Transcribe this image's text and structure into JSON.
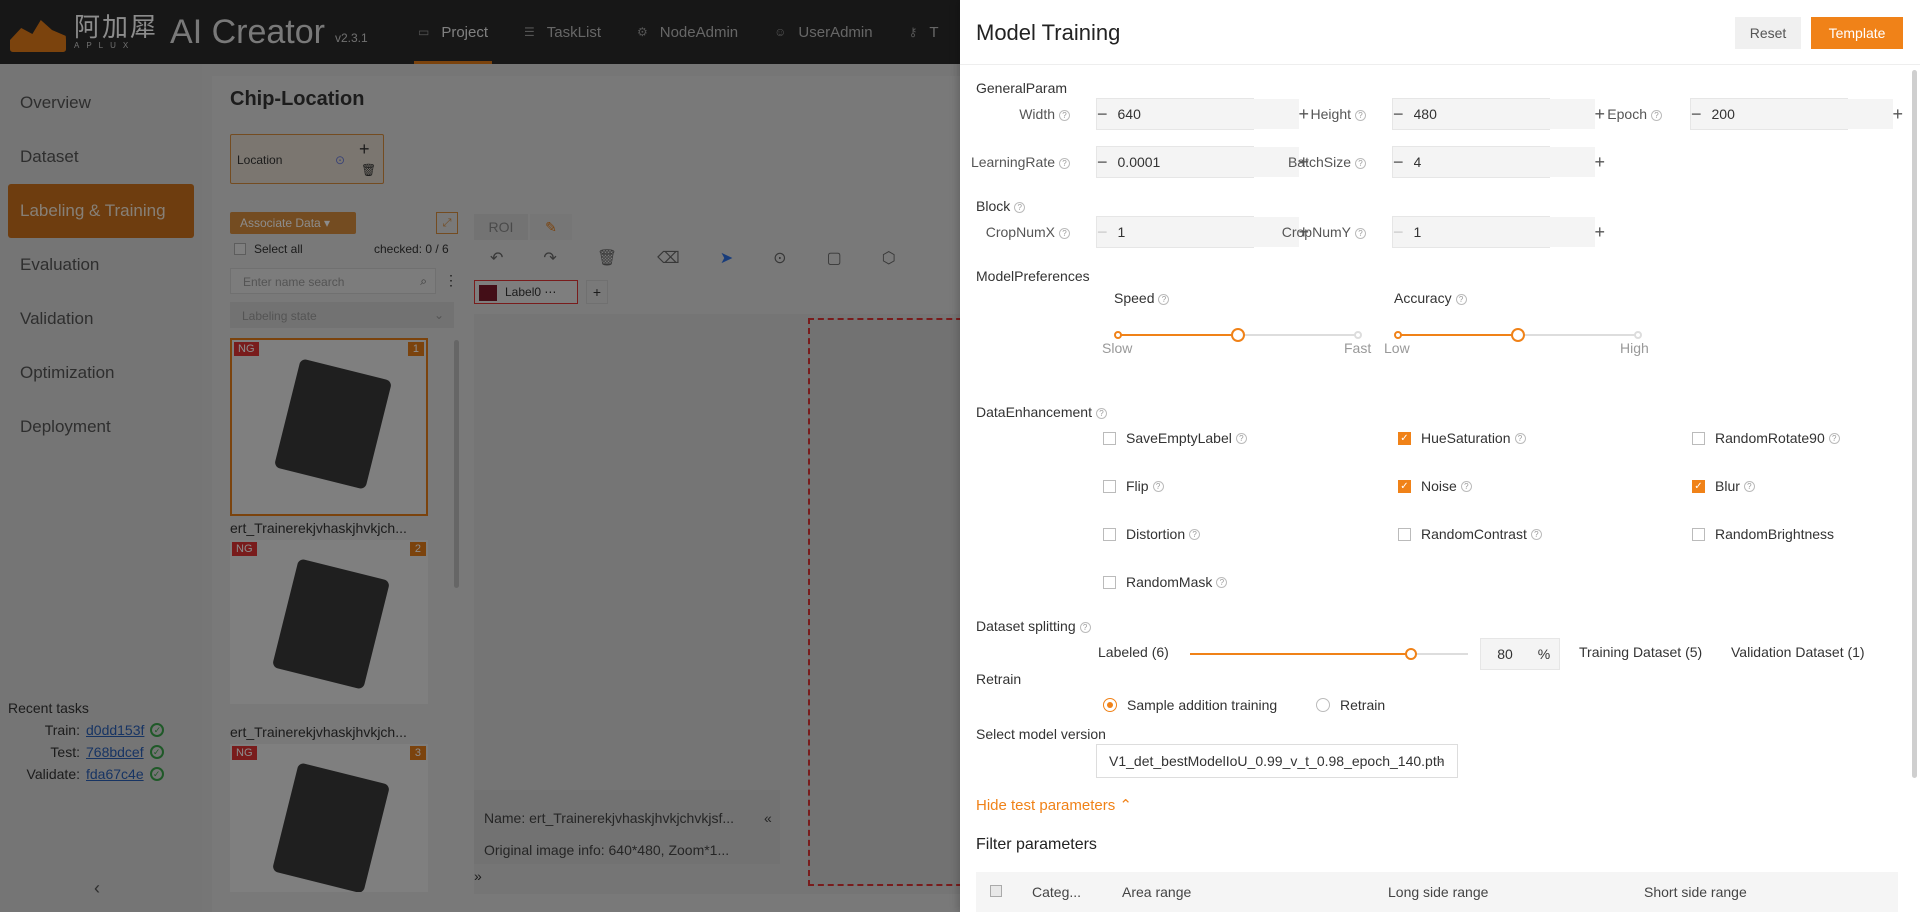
{
  "app": {
    "logo_cn": "阿加犀",
    "logo_sub": "APLUX",
    "name": "AI Creator",
    "version": "v2.3.1"
  },
  "nav": [
    {
      "label": "Project",
      "icon": "folder-icon"
    },
    {
      "label": "TaskList",
      "icon": "list-icon"
    },
    {
      "label": "NodeAdmin",
      "icon": "node-icon"
    },
    {
      "label": "UserAdmin",
      "icon": "user-icon"
    },
    {
      "label": "T",
      "icon": "key-icon"
    }
  ],
  "sidebar": {
    "items": [
      {
        "label": "Overview"
      },
      {
        "label": "Dataset"
      },
      {
        "label": "Labeling & Training"
      },
      {
        "label": "Evaluation"
      },
      {
        "label": "Validation"
      },
      {
        "label": "Optimization"
      },
      {
        "label": "Deployment"
      }
    ],
    "active_index": 2,
    "recent_title": "Recent tasks",
    "recent": [
      {
        "label": "Train:",
        "id": "d0dd153f"
      },
      {
        "label": "Test:",
        "id": "768bdcef"
      },
      {
        "label": "Validate:",
        "id": "fda67c4e"
      }
    ],
    "collapse": "‹"
  },
  "project": {
    "title": "Chip-Location",
    "location_card": "Location",
    "associate_label": "Associate Data",
    "select_all": "Select all",
    "checked": "checked:  0 / 6",
    "search_placeholder": "Enter name search",
    "labeling_state": "Labeling state",
    "images": [
      {
        "tag": "NG",
        "num": "1",
        "caption": "ert_Trainerekjvhaskjhvkjch..."
      },
      {
        "tag": "NG",
        "num": "2",
        "caption": "ert_Trainerekjvhaskjhvkjch..."
      },
      {
        "tag": "NG",
        "num": "3",
        "caption": ""
      }
    ],
    "roi_tab": "ROI",
    "label_name": "Label0",
    "info_name": "Name:  ert_Trainerekjvhaskjhvkjchvkjsf...",
    "info_image": "Original image info:  640*480,  Zoom*1...",
    "info_collapse": "«",
    "info_expand": "»"
  },
  "panel": {
    "title": "Model Training",
    "reset": "Reset",
    "template": "Template",
    "general_param": "GeneralParam",
    "width_label": "Width",
    "width_value": "640",
    "height_label": "Height",
    "height_value": "480",
    "epoch_label": "Epoch",
    "epoch_value": "200",
    "lr_label": "LearningRate",
    "lr_value": "0.0001",
    "batch_label": "BatchSize",
    "batch_value": "4",
    "block": "Block",
    "cropx_label": "CropNumX",
    "cropx_value": "1",
    "cropy_label": "CropNumY",
    "cropy_value": "1",
    "model_pref": "ModelPreferences",
    "speed_label": "Speed",
    "speed_min": "Slow",
    "speed_max": "Fast",
    "speed_level": 0.5,
    "accuracy_label": "Accuracy",
    "accuracy_min": "Low",
    "accuracy_max": "High",
    "accuracy_level": 0.5,
    "data_enh": "DataEnhancement",
    "enh": [
      {
        "label": "SaveEmptyLabel",
        "checked": false
      },
      {
        "label": "HueSaturation",
        "checked": true
      },
      {
        "label": "RandomRotate90",
        "checked": false
      },
      {
        "label": "Flip",
        "checked": false
      },
      {
        "label": "Noise",
        "checked": true
      },
      {
        "label": "Blur",
        "checked": true
      },
      {
        "label": "Distortion",
        "checked": false
      },
      {
        "label": "RandomContrast",
        "checked": false
      },
      {
        "label": "RandomBrightness",
        "checked": false
      },
      {
        "label": "RandomMask",
        "checked": false
      }
    ],
    "split_title": "Dataset splitting",
    "labeled": "Labeled (6)",
    "split_value": "80",
    "split_pct": "%",
    "split_level": 0.8,
    "train_ds": "Training Dataset (5)",
    "val_ds": "Validation Dataset (1)",
    "retrain": "Retrain",
    "opt_sample": "Sample addition training",
    "opt_retrain": "Retrain",
    "select_model_label": "Select model version",
    "model_version": "V1_det_bestModelIoU_0.99_v_t_0.98_epoch_140.pth",
    "hide_test": "Hide test parameters",
    "filter_title": "Filter parameters",
    "cols": [
      "Categ...",
      "Area range",
      "Long side range",
      "Short side range"
    ]
  },
  "colors": {
    "accent": "#f08218",
    "danger": "#dd3333",
    "link": "#2b5fb5"
  }
}
